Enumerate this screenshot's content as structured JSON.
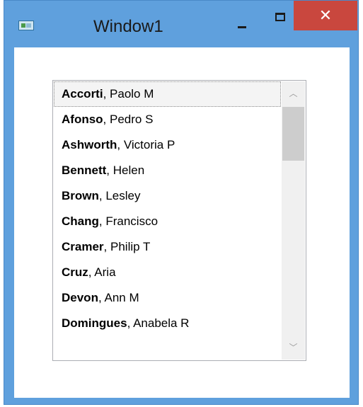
{
  "window": {
    "title": "Window1",
    "close_glyph": "✕",
    "icons": {
      "app": "app-window-icon",
      "minimize": "minimize-icon",
      "maximize": "maximize-icon",
      "close": "close-icon"
    },
    "colors": {
      "frame": "#5fa0dd",
      "close_button": "#c9473e"
    }
  },
  "listbox": {
    "selected_index": 0,
    "items": [
      {
        "last": "Accorti",
        "rest": ", Paolo M"
      },
      {
        "last": "Afonso",
        "rest": ", Pedro S"
      },
      {
        "last": "Ashworth",
        "rest": ", Victoria P"
      },
      {
        "last": "Bennett",
        "rest": ", Helen"
      },
      {
        "last": "Brown",
        "rest": ", Lesley"
      },
      {
        "last": "Chang",
        "rest": ", Francisco"
      },
      {
        "last": "Cramer",
        "rest": ", Philip T"
      },
      {
        "last": "Cruz",
        "rest": ", Aria"
      },
      {
        "last": "Devon",
        "rest": ", Ann M"
      },
      {
        "last": "Domingues",
        "rest": ", Anabela R"
      }
    ],
    "scrollbar": {
      "up_glyph": "︿",
      "down_glyph": "﹀"
    }
  }
}
